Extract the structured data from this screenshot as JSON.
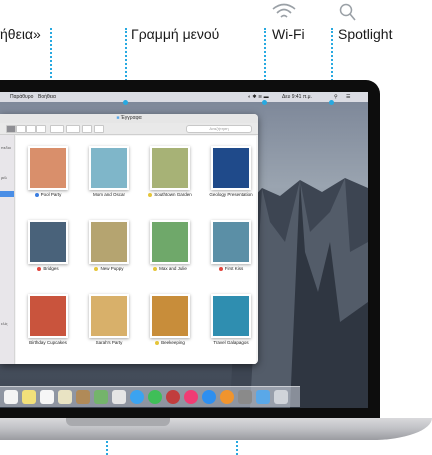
{
  "callouts": {
    "help_partial": "ήθεια»",
    "menu_bar": "Γραμμή μενού",
    "wifi": "Wi-Fi",
    "spotlight": "Spotlight"
  },
  "icons": {
    "wifi": "wifi-icon",
    "spotlight": "magnifier-icon"
  },
  "colors": {
    "callout_line": "#28a9e0"
  },
  "menubar": {
    "items": [
      "Παράθυρο",
      "Βοήθεια"
    ],
    "clock": "Δευ 9:41 π.μ."
  },
  "finder": {
    "title": "Έγγραφα",
    "search_placeholder": "Αναζήτηση",
    "sidebar": [
      "πεδιο",
      "ρέλ",
      "",
      "",
      "",
      "",
      "ελίς"
    ],
    "items": [
      {
        "label": "Pool Party",
        "tag": "#3a7de0",
        "thumb": "#d98f6b"
      },
      {
        "label": "Mom and Oscar",
        "tag": "",
        "thumb": "#7fb6c9"
      },
      {
        "label": "Southtown Garden",
        "tag": "#e5c53a",
        "thumb": "#a7b276"
      },
      {
        "label": "Geology Presentation",
        "tag": "",
        "thumb": "#1f4a8a"
      },
      {
        "label": "Bridges",
        "tag": "#e2453c",
        "thumb": "#49627a"
      },
      {
        "label": "New Puppy",
        "tag": "#e5c53a",
        "thumb": "#b5a470"
      },
      {
        "label": "Max and Julie",
        "tag": "#e5c53a",
        "thumb": "#6fa86a"
      },
      {
        "label": "First Kiss",
        "tag": "#e2453c",
        "thumb": "#5b8fa6"
      },
      {
        "label": "Birthday Cupcakes",
        "tag": "",
        "thumb": "#c9543d"
      },
      {
        "label": "Sarah's Party",
        "tag": "",
        "thumb": "#d8b06a"
      },
      {
        "label": "Beekeeping",
        "tag": "#e5c53a",
        "thumb": "#c88d3a"
      },
      {
        "label": "Travel Galapagos",
        "tag": "",
        "thumb": "#2f8eb0"
      }
    ]
  },
  "dock": {
    "apps": [
      {
        "name": "calendar-app",
        "color": "#f4f4f4"
      },
      {
        "name": "notes-app",
        "color": "#f2e07a"
      },
      {
        "name": "reminders-app",
        "color": "#f6f6f6"
      },
      {
        "name": "notes-app-2",
        "color": "#e9e3c3"
      },
      {
        "name": "contacts-app",
        "color": "#b08a58"
      },
      {
        "name": "maps-app",
        "color": "#74b46b"
      },
      {
        "name": "photos-app",
        "color": "#e5e5e5"
      },
      {
        "name": "messages-app",
        "color": "#3ba3f0"
      },
      {
        "name": "facetime-app",
        "color": "#3fbf58"
      },
      {
        "name": "photo-booth-app",
        "color": "#c13d3d"
      },
      {
        "name": "itunes-app",
        "color": "#f03c74"
      },
      {
        "name": "app-store-app",
        "color": "#2e8ff0"
      },
      {
        "name": "ibooks-app",
        "color": "#f0942e"
      },
      {
        "name": "system-preferences-app",
        "color": "#8a8a8a"
      },
      {
        "name": "downloads-folder",
        "color": "#5aa8e8"
      },
      {
        "name": "trash",
        "color": "#d0d4da"
      }
    ]
  }
}
